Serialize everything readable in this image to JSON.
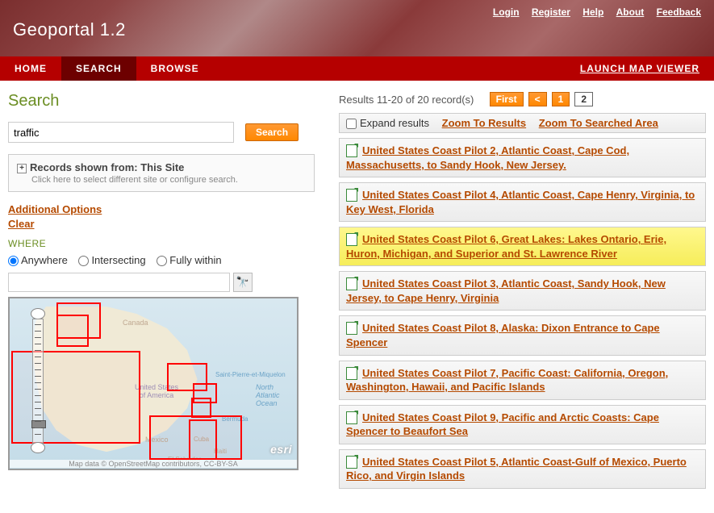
{
  "app_title": "Geoportal 1.2",
  "top_links": [
    "Login",
    "Register",
    "Help",
    "About",
    "Feedback"
  ],
  "nav": {
    "items": [
      "HOME",
      "SEARCH",
      "BROWSE"
    ],
    "active": 1,
    "right": "LAUNCH MAP VIEWER"
  },
  "page_heading": "Search",
  "search": {
    "value": "traffic",
    "button": "Search"
  },
  "config": {
    "title": "Records shown from: This Site",
    "sub": "Click here to select different site or configure search."
  },
  "options": {
    "additional": "Additional Options",
    "clear": "Clear"
  },
  "where": {
    "label": "WHERE",
    "radios": [
      {
        "label": "Anywhere",
        "checked": true
      },
      {
        "label": "Intersecting",
        "checked": false
      },
      {
        "label": "Fully within",
        "checked": false
      }
    ],
    "loc_value": ""
  },
  "map": {
    "labels": {
      "canada": "Canada",
      "usa": "United States\nof America",
      "mexico": "Mexico",
      "cuba": "Cuba",
      "haiti": "Haiti",
      "na_ocean": "North\nAtlantic\nOcean",
      "bermuda": "Bermuda",
      "spm": "Saint-Pierre-et-Miquelon",
      "elsalv": "El Salvador"
    },
    "attribution": "Map data © OpenStreetMap contributors, CC-BY-SA",
    "logo": "esri"
  },
  "results": {
    "summary": "Results 11-20 of 20 record(s)",
    "pager": {
      "first": "First",
      "prev": "<",
      "pages": [
        "1",
        "2"
      ],
      "current": "2"
    },
    "expand": {
      "label": "Expand results",
      "zoom_results": "Zoom To Results",
      "zoom_area": "Zoom To Searched Area"
    },
    "items": [
      {
        "title": "United States Coast Pilot 2, Atlantic Coast, Cape Cod, Massachusetts, to Sandy Hook, New Jersey.",
        "hl": false
      },
      {
        "title": "United States Coast Pilot 4, Atlantic Coast, Cape Henry, Virginia, to Key West, Florida",
        "hl": false
      },
      {
        "title": "United States Coast Pilot 6, Great Lakes: Lakes Ontario, Erie, Huron, Michigan, and Superior and St. Lawrence River",
        "hl": true
      },
      {
        "title": "United States Coast Pilot 3, Atlantic Coast, Sandy Hook, New Jersey, to Cape Henry, Virginia",
        "hl": false
      },
      {
        "title": "United States Coast Pilot 8, Alaska: Dixon Entrance to Cape Spencer",
        "hl": false
      },
      {
        "title": "United States Coast Pilot 7, Pacific Coast: California, Oregon, Washington, Hawaii, and Pacific Islands",
        "hl": false
      },
      {
        "title": "United States Coast Pilot 9, Pacific and Arctic Coasts: Cape Spencer to Beaufort Sea",
        "hl": false
      },
      {
        "title": "United States Coast Pilot 5, Atlantic Coast-Gulf of Mexico, Puerto Rico, and Virgin Islands",
        "hl": false
      }
    ]
  }
}
